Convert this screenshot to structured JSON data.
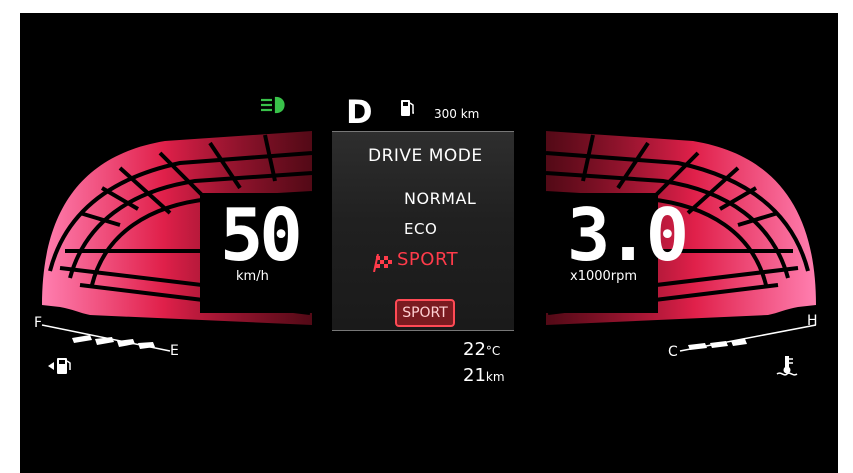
{
  "gear": "D",
  "range": "300 km",
  "speed": {
    "value": "50",
    "unit": "km/h"
  },
  "tachometer": {
    "value": "3.0",
    "unit": "x1000rpm"
  },
  "drive_mode": {
    "title": "DRIVE MODE",
    "options": [
      "NORMAL",
      "ECO",
      "SPORT"
    ],
    "selected": "SPORT",
    "badge": "SPORT"
  },
  "fuel_gauge": {
    "full_label": "F",
    "empty_label": "E",
    "level": 0.5
  },
  "temp_gauge": {
    "cold_label": "C",
    "hot_label": "H",
    "level": 0.35
  },
  "outside_temp": {
    "value": "22",
    "unit": "°C"
  },
  "trip": {
    "value": "21",
    "unit": "km"
  },
  "colors": {
    "accent": "#ff3b4a",
    "headlight": "#39c24a",
    "gauge_red": "#e0204a",
    "gauge_pink": "#ff6f9f"
  },
  "icons": [
    "headlight-icon",
    "fuel-pump-icon",
    "checkered-flag-icon",
    "fuel-door-icon",
    "coolant-temperature-icon"
  ]
}
